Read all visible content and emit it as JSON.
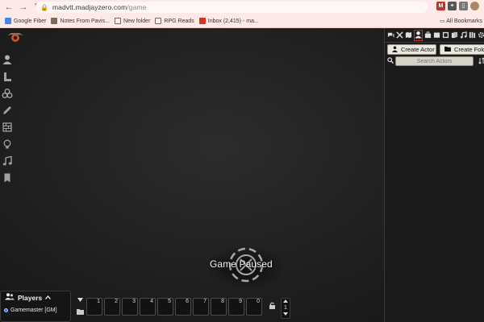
{
  "browser": {
    "url_host": "madvtt.madjayzero.com",
    "url_path": "/game",
    "bookmarks": [
      {
        "label": "Google Fiber",
        "color": "#4285f4"
      },
      {
        "label": "Notes From Pavis...",
        "color": "#7a6b5d"
      },
      {
        "label": "New folder",
        "color": "#6b6b6b"
      },
      {
        "label": "RPG Reads",
        "color": "#6b6b6b"
      },
      {
        "label": "Inbox (2,415) - ma...",
        "color": "#d93025"
      }
    ],
    "all_bookmarks": "All Bookmarks"
  },
  "left_tools": [
    {
      "name": "token-controls-icon",
      "glyph": "👤"
    },
    {
      "name": "measure-controls-icon",
      "glyph": "∟"
    },
    {
      "name": "tile-controls-icon",
      "glyph": "⚙"
    },
    {
      "name": "drawing-tools-icon",
      "glyph": "✎"
    },
    {
      "name": "walls-icon",
      "glyph": "▦"
    },
    {
      "name": "lighting-icon",
      "glyph": "💡"
    },
    {
      "name": "sound-icon",
      "glyph": "♫"
    },
    {
      "name": "notes-icon",
      "glyph": "🔖"
    }
  ],
  "sidebar": {
    "tabs": [
      {
        "name": "chat-tab-icon",
        "glyph": "💬"
      },
      {
        "name": "combat-tab-icon",
        "glyph": "⚔"
      },
      {
        "name": "scenes-tab-icon",
        "glyph": "▤"
      },
      {
        "name": "actors-tab-icon",
        "glyph": "👤",
        "active": true
      },
      {
        "name": "items-tab-icon",
        "glyph": "💼"
      },
      {
        "name": "journal-tab-icon",
        "glyph": "📖"
      },
      {
        "name": "tables-tab-icon",
        "glyph": "▥"
      },
      {
        "name": "cards-tab-icon",
        "glyph": "🂠"
      },
      {
        "name": "playlists-tab-icon",
        "glyph": "♫"
      },
      {
        "name": "compendium-tab-icon",
        "glyph": "📚"
      },
      {
        "name": "settings-tab-icon",
        "glyph": "⚙"
      }
    ],
    "create_actor": "Create Actor",
    "create_folder": "Create Folder",
    "search_placeholder": "Search Actors"
  },
  "game": {
    "paused_text": "Game Paused"
  },
  "players": {
    "title": "Players",
    "list": [
      {
        "label": "Gamemaster [GM]",
        "color": "#4a62ff"
      }
    ]
  },
  "hotbar": {
    "slots": [
      "1",
      "2",
      "3",
      "4",
      "5",
      "6",
      "7",
      "8",
      "9",
      "0"
    ],
    "page": "1"
  },
  "colors": {
    "accent": "#c5302b",
    "player_gm": "#4a62ff"
  }
}
